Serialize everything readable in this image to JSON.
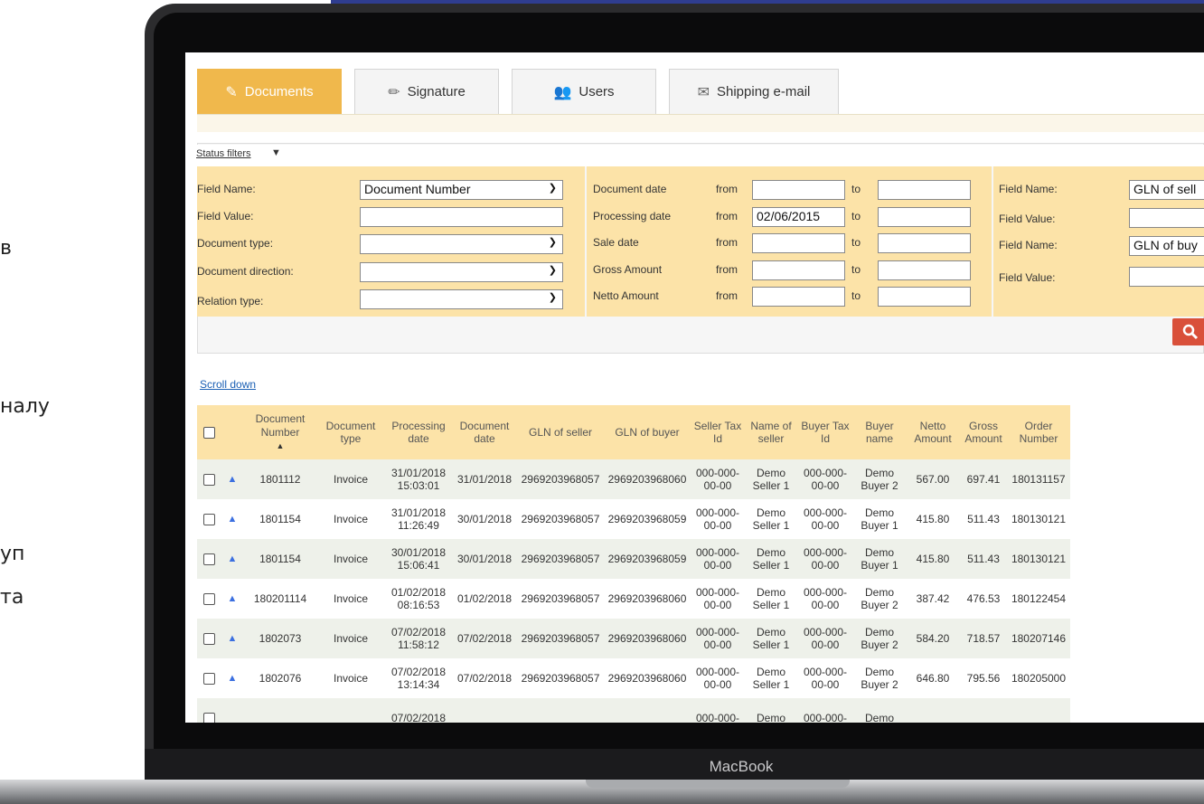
{
  "page": {
    "side_text": [
      "в",
      "налу",
      "уп",
      "та"
    ],
    "device_label": "MacBook"
  },
  "tabs": [
    {
      "label": "Documents",
      "icon": "edit-document-icon",
      "active": true
    },
    {
      "label": "Signature",
      "icon": "pen-icon",
      "active": false
    },
    {
      "label": "Users",
      "icon": "users-icon",
      "active": false
    },
    {
      "label": "Shipping e-mail",
      "icon": "mail-icon",
      "active": false
    }
  ],
  "filters": {
    "status_filters_label": "Status filters",
    "left": {
      "field_name_label": "Field Name:",
      "field_name_value": "Document Number",
      "field_value_label": "Field Value:",
      "field_value_value": "",
      "document_type_label": "Document type:",
      "document_direction_label": "Document direction:",
      "relation_type_label": "Relation type:"
    },
    "middle": {
      "rows": [
        {
          "label": "Document date",
          "from_label": "from",
          "from_value": "",
          "to_label": "to",
          "to_value": ""
        },
        {
          "label": "Processing date",
          "from_label": "from",
          "from_value": "02/06/2015",
          "to_label": "to",
          "to_value": ""
        },
        {
          "label": "Sale date",
          "from_label": "from",
          "from_value": "",
          "to_label": "to",
          "to_value": ""
        },
        {
          "label": "Gross Amount",
          "from_label": "from",
          "from_value": "",
          "to_label": "to",
          "to_value": ""
        },
        {
          "label": "Netto Amount",
          "from_label": "from",
          "from_value": "",
          "to_label": "to",
          "to_value": ""
        }
      ]
    },
    "right": {
      "field_name_label_1": "Field Name:",
      "field_name_value_1": "GLN of sell",
      "field_value_label_1": "Field Value:",
      "field_name_label_2": "Field Name:",
      "field_name_value_2": "GLN of buy",
      "field_value_label_2": "Field Value:"
    },
    "search_icon": "search-icon"
  },
  "scroll_down_label": "Scroll down",
  "table": {
    "headers": [
      "Document Number",
      "Document type",
      "Processing date",
      "Document date",
      "GLN of seller",
      "GLN of buyer",
      "Seller Tax Id",
      "Name of seller",
      "Buyer Tax Id",
      "Buyer name",
      "Netto Amount",
      "Gross Amount",
      "Order Number"
    ],
    "sort_indicator": "▲",
    "rows": [
      {
        "doc_number": "1801112",
        "doc_type": "Invoice",
        "proc_date": "31/01/2018",
        "proc_time": "15:03:01",
        "doc_date": "31/01/2018",
        "gln_seller": "2969203968057",
        "gln_buyer": "2969203968060",
        "seller_tax_1": "000-000-",
        "seller_tax_2": "00-00",
        "seller_name_1": "Demo",
        "seller_name_2": "Seller 1",
        "buyer_tax_1": "000-000-",
        "buyer_tax_2": "00-00",
        "buyer_name_1": "Demo",
        "buyer_name_2": "Buyer 2",
        "netto": "567.00",
        "gross": "697.41",
        "order": "180131157"
      },
      {
        "doc_number": "1801154",
        "doc_type": "Invoice",
        "proc_date": "31/01/2018",
        "proc_time": "11:26:49",
        "doc_date": "30/01/2018",
        "gln_seller": "2969203968057",
        "gln_buyer": "2969203968059",
        "seller_tax_1": "000-000-",
        "seller_tax_2": "00-00",
        "seller_name_1": "Demo",
        "seller_name_2": "Seller 1",
        "buyer_tax_1": "000-000-",
        "buyer_tax_2": "00-00",
        "buyer_name_1": "Demo",
        "buyer_name_2": "Buyer 1",
        "netto": "415.80",
        "gross": "511.43",
        "order": "180130121"
      },
      {
        "doc_number": "1801154",
        "doc_type": "Invoice",
        "proc_date": "30/01/2018",
        "proc_time": "15:06:41",
        "doc_date": "30/01/2018",
        "gln_seller": "2969203968057",
        "gln_buyer": "2969203968059",
        "seller_tax_1": "000-000-",
        "seller_tax_2": "00-00",
        "seller_name_1": "Demo",
        "seller_name_2": "Seller 1",
        "buyer_tax_1": "000-000-",
        "buyer_tax_2": "00-00",
        "buyer_name_1": "Demo",
        "buyer_name_2": "Buyer 1",
        "netto": "415.80",
        "gross": "511.43",
        "order": "180130121"
      },
      {
        "doc_number": "180201114",
        "doc_type": "Invoice",
        "proc_date": "01/02/2018",
        "proc_time": "08:16:53",
        "doc_date": "01/02/2018",
        "gln_seller": "2969203968057",
        "gln_buyer": "2969203968060",
        "seller_tax_1": "000-000-",
        "seller_tax_2": "00-00",
        "seller_name_1": "Demo",
        "seller_name_2": "Seller 1",
        "buyer_tax_1": "000-000-",
        "buyer_tax_2": "00-00",
        "buyer_name_1": "Demo",
        "buyer_name_2": "Buyer 2",
        "netto": "387.42",
        "gross": "476.53",
        "order": "180122454"
      },
      {
        "doc_number": "1802073",
        "doc_type": "Invoice",
        "proc_date": "07/02/2018",
        "proc_time": "11:58:12",
        "doc_date": "07/02/2018",
        "gln_seller": "2969203968057",
        "gln_buyer": "2969203968060",
        "seller_tax_1": "000-000-",
        "seller_tax_2": "00-00",
        "seller_name_1": "Demo",
        "seller_name_2": "Seller 1",
        "buyer_tax_1": "000-000-",
        "buyer_tax_2": "00-00",
        "buyer_name_1": "Demo",
        "buyer_name_2": "Buyer 2",
        "netto": "584.20",
        "gross": "718.57",
        "order": "180207146"
      },
      {
        "doc_number": "1802076",
        "doc_type": "Invoice",
        "proc_date": "07/02/2018",
        "proc_time": "13:14:34",
        "doc_date": "07/02/2018",
        "gln_seller": "2969203968057",
        "gln_buyer": "2969203968060",
        "seller_tax_1": "000-000-",
        "seller_tax_2": "00-00",
        "seller_name_1": "Demo",
        "seller_name_2": "Seller 1",
        "buyer_tax_1": "000-000-",
        "buyer_tax_2": "00-00",
        "buyer_name_1": "Demo",
        "buyer_name_2": "Buyer 2",
        "netto": "646.80",
        "gross": "795.56",
        "order": "180205000"
      },
      {
        "doc_number": "",
        "doc_type": "",
        "proc_date": "07/02/2018",
        "proc_time": "",
        "doc_date": "",
        "gln_seller": "",
        "gln_buyer": "",
        "seller_tax_1": "000-000-",
        "seller_tax_2": "",
        "seller_name_1": "Demo",
        "seller_name_2": "",
        "buyer_tax_1": "000-000-",
        "buyer_tax_2": "",
        "buyer_name_1": "Demo",
        "buyer_name_2": "",
        "netto": "",
        "gross": "",
        "order": ""
      }
    ]
  },
  "colors": {
    "accent": "#f0b84c",
    "filter_bg": "#fce3a8",
    "row_alt": "#eef1ea",
    "search_button": "#d9503a",
    "top_band": "#2f3d8f"
  }
}
